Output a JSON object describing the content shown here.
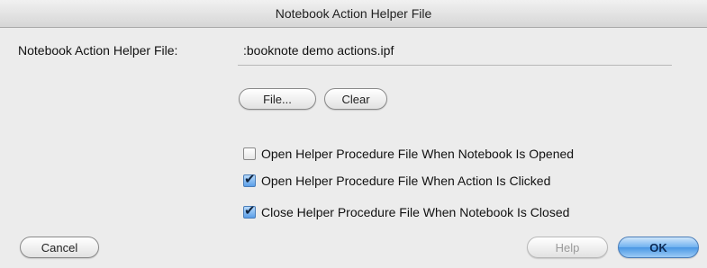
{
  "window": {
    "title": "Notebook Action Helper File"
  },
  "helper": {
    "label": "Notebook Action Helper File:",
    "path": ":booknote demo actions.ipf"
  },
  "buttons": {
    "file": "File...",
    "clear": "Clear",
    "cancel": "Cancel",
    "help": "Help",
    "ok": "OK"
  },
  "options": [
    {
      "label": "Open Helper Procedure File When Notebook Is Opened",
      "checked": false
    },
    {
      "label": "Open Helper Procedure File When Action Is Clicked",
      "checked": true
    },
    {
      "label": "Close Helper Procedure File When Notebook Is Closed",
      "checked": true
    }
  ],
  "check_glyph": "✔"
}
